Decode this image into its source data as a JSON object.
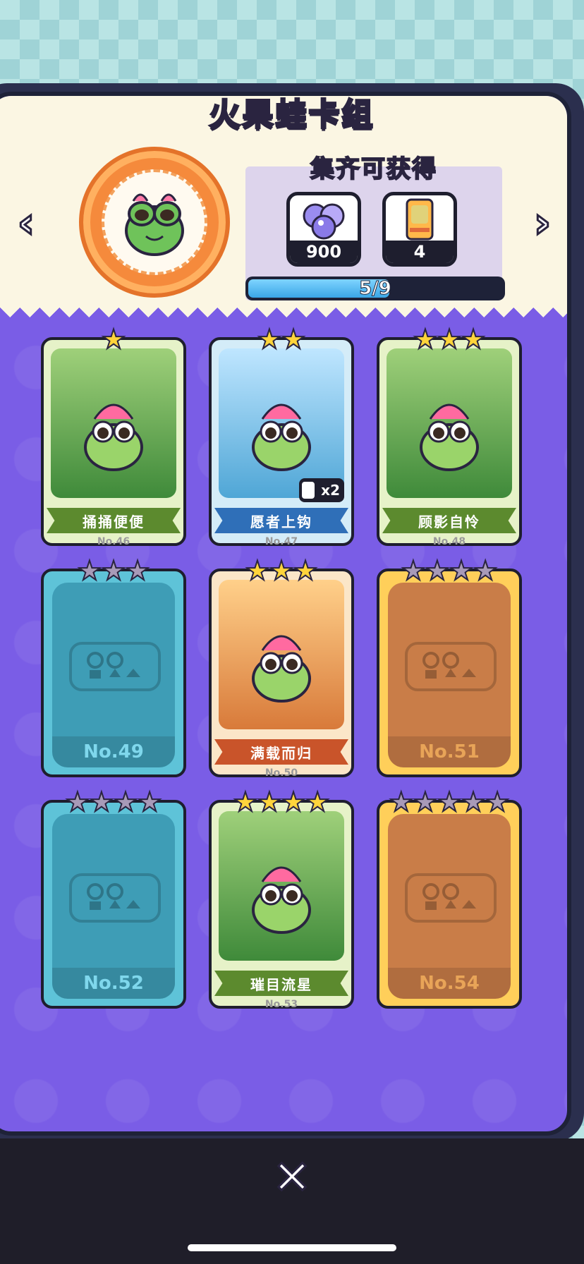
{
  "title": "火果蛙卡组",
  "reward": {
    "title": "集齐可获得",
    "items": [
      {
        "icon": "gem-orbs-icon",
        "count": "900"
      },
      {
        "icon": "card-pack-icon",
        "count": "4"
      }
    ],
    "progress_text": "5/9",
    "progress_fraction": 0.5556
  },
  "cards": [
    {
      "no": "No.46",
      "name": "捅捅便便",
      "stars_total": 1,
      "stars_lit": 1,
      "unlocked": true,
      "theme": "green"
    },
    {
      "no": "No.47",
      "name": "愿者上钩",
      "stars_total": 2,
      "stars_lit": 2,
      "unlocked": true,
      "theme": "blue",
      "badge": "x2"
    },
    {
      "no": "No.48",
      "name": "顾影自怜",
      "stars_total": 3,
      "stars_lit": 3,
      "unlocked": true,
      "theme": "green"
    },
    {
      "no": "No.49",
      "name": "",
      "stars_total": 3,
      "stars_lit": 0,
      "unlocked": false,
      "theme": "blue"
    },
    {
      "no": "No.50",
      "name": "满载而归",
      "stars_total": 3,
      "stars_lit": 3,
      "unlocked": true,
      "theme": "orange"
    },
    {
      "no": "No.51",
      "name": "",
      "stars_total": 4,
      "stars_lit": 0,
      "unlocked": false,
      "theme": "orange"
    },
    {
      "no": "No.52",
      "name": "",
      "stars_total": 4,
      "stars_lit": 0,
      "unlocked": false,
      "theme": "blue"
    },
    {
      "no": "No.53",
      "name": "璀目流星",
      "stars_total": 4,
      "stars_lit": 4,
      "unlocked": true,
      "theme": "green"
    },
    {
      "no": "No.54",
      "name": "",
      "stars_total": 5,
      "stars_lit": 0,
      "unlocked": false,
      "theme": "orange"
    }
  ],
  "colors": {
    "panel": "#7a5de6",
    "gold": "#ffd43b",
    "green_ribbon": "#5c8a2e",
    "blue_ribbon": "#2f6fb8",
    "orange_ribbon": "#c9542a"
  }
}
